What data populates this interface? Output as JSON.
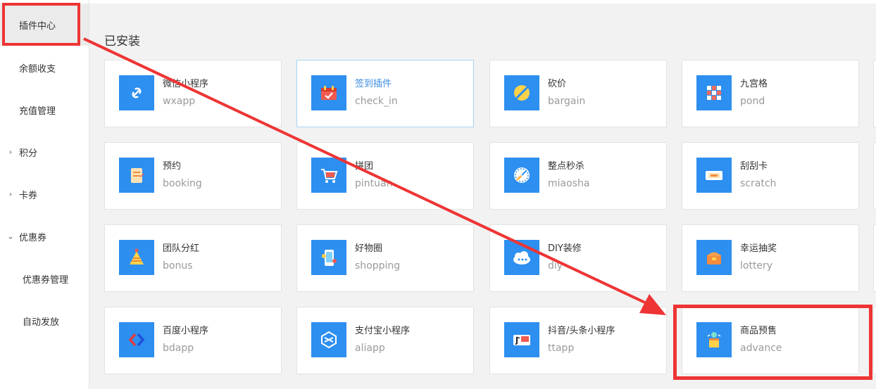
{
  "sidebar": {
    "items": [
      {
        "label": "插件中心",
        "active": true
      },
      {
        "label": "余额收支"
      },
      {
        "label": "充值管理"
      },
      {
        "label": "积分",
        "arrow": "›"
      },
      {
        "label": "卡券",
        "arrow": "›"
      },
      {
        "label": "优惠券",
        "arrow": "⌄"
      },
      {
        "label": "优惠券管理"
      },
      {
        "label": "自动发放"
      }
    ]
  },
  "main": {
    "section_title": "已安装",
    "plugins": [
      {
        "name": "微信小程序",
        "code": "wxapp",
        "icon": "link-icon"
      },
      {
        "name": "签到插件",
        "code": "check_in",
        "icon": "calendar-icon"
      },
      {
        "name": "砍价",
        "code": "bargain",
        "icon": "cut-icon"
      },
      {
        "name": "九宫格",
        "code": "pond",
        "icon": "grid-icon"
      },
      {
        "name": "预约",
        "code": "booking",
        "icon": "clipboard-icon"
      },
      {
        "name": "拼团",
        "code": "pintuan",
        "icon": "cart-icon"
      },
      {
        "name": "整点秒杀",
        "code": "miaosha",
        "icon": "clock-icon"
      },
      {
        "name": "刮刮卡",
        "code": "scratch",
        "icon": "ticket-icon"
      },
      {
        "name": "团队分红",
        "code": "bonus",
        "icon": "pyramid-icon"
      },
      {
        "name": "好物圈",
        "code": "shopping",
        "icon": "phone-icon"
      },
      {
        "name": "DIY装修",
        "code": "diy",
        "icon": "cloud-icon"
      },
      {
        "name": "幸运抽奖",
        "code": "lottery",
        "icon": "chest-icon"
      },
      {
        "name": "百度小程序",
        "code": "bdapp",
        "icon": "baidu-icon"
      },
      {
        "name": "支付宝小程序",
        "code": "aliapp",
        "icon": "alipay-icon"
      },
      {
        "name": "抖音/头条小程序",
        "code": "ttapp",
        "icon": "toutiao-icon"
      },
      {
        "name": "商品预售",
        "code": "advance",
        "icon": "gift-icon"
      }
    ]
  },
  "colors": {
    "accent": "#2d8ff0",
    "highlight": "#ee3434",
    "hover_text": "#3d8ee0"
  }
}
